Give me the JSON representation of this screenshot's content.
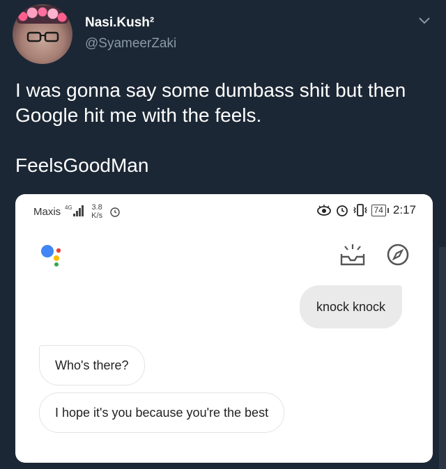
{
  "user": {
    "display_name": "Nasi.Kush²",
    "handle": "@SyameerZaki"
  },
  "tweet": {
    "text": "I was gonna say some dumbass shit but then Google hit me with the feels.",
    "tag_line": "FeelsGoodMan"
  },
  "phone": {
    "status_bar": {
      "carrier": "Maxis",
      "network": "4G",
      "speed_value": "3.8",
      "speed_unit": "K/s",
      "battery": "74",
      "time": "2:17"
    },
    "icons": {
      "assistant": "google-assistant-icon",
      "snapshot": "inbox-snapshot-icon",
      "explore": "compass-icon"
    },
    "conversation": {
      "user_message": "knock knock",
      "assistant_messages": [
        "Who's there?",
        "I hope it's you because you're the best"
      ]
    }
  },
  "colors": {
    "background": "#1c2735",
    "handle": "#8899a6",
    "card": "#ffffff",
    "user_bubble": "#eaeaea",
    "assistant_blue": "#4285f4",
    "assistant_red": "#ea4335",
    "assistant_yellow": "#fbbc05",
    "assistant_green": "#34a853"
  }
}
